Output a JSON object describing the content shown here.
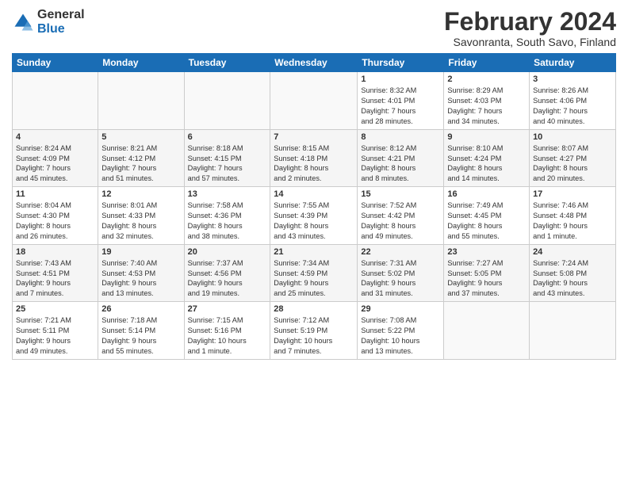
{
  "logo": {
    "general": "General",
    "blue": "Blue"
  },
  "title": "February 2024",
  "subtitle": "Savonranta, South Savo, Finland",
  "headers": [
    "Sunday",
    "Monday",
    "Tuesday",
    "Wednesday",
    "Thursday",
    "Friday",
    "Saturday"
  ],
  "weeks": [
    [
      {
        "day": "",
        "info": ""
      },
      {
        "day": "",
        "info": ""
      },
      {
        "day": "",
        "info": ""
      },
      {
        "day": "",
        "info": ""
      },
      {
        "day": "1",
        "info": "Sunrise: 8:32 AM\nSunset: 4:01 PM\nDaylight: 7 hours\nand 28 minutes."
      },
      {
        "day": "2",
        "info": "Sunrise: 8:29 AM\nSunset: 4:03 PM\nDaylight: 7 hours\nand 34 minutes."
      },
      {
        "day": "3",
        "info": "Sunrise: 8:26 AM\nSunset: 4:06 PM\nDaylight: 7 hours\nand 40 minutes."
      }
    ],
    [
      {
        "day": "4",
        "info": "Sunrise: 8:24 AM\nSunset: 4:09 PM\nDaylight: 7 hours\nand 45 minutes."
      },
      {
        "day": "5",
        "info": "Sunrise: 8:21 AM\nSunset: 4:12 PM\nDaylight: 7 hours\nand 51 minutes."
      },
      {
        "day": "6",
        "info": "Sunrise: 8:18 AM\nSunset: 4:15 PM\nDaylight: 7 hours\nand 57 minutes."
      },
      {
        "day": "7",
        "info": "Sunrise: 8:15 AM\nSunset: 4:18 PM\nDaylight: 8 hours\nand 2 minutes."
      },
      {
        "day": "8",
        "info": "Sunrise: 8:12 AM\nSunset: 4:21 PM\nDaylight: 8 hours\nand 8 minutes."
      },
      {
        "day": "9",
        "info": "Sunrise: 8:10 AM\nSunset: 4:24 PM\nDaylight: 8 hours\nand 14 minutes."
      },
      {
        "day": "10",
        "info": "Sunrise: 8:07 AM\nSunset: 4:27 PM\nDaylight: 8 hours\nand 20 minutes."
      }
    ],
    [
      {
        "day": "11",
        "info": "Sunrise: 8:04 AM\nSunset: 4:30 PM\nDaylight: 8 hours\nand 26 minutes."
      },
      {
        "day": "12",
        "info": "Sunrise: 8:01 AM\nSunset: 4:33 PM\nDaylight: 8 hours\nand 32 minutes."
      },
      {
        "day": "13",
        "info": "Sunrise: 7:58 AM\nSunset: 4:36 PM\nDaylight: 8 hours\nand 38 minutes."
      },
      {
        "day": "14",
        "info": "Sunrise: 7:55 AM\nSunset: 4:39 PM\nDaylight: 8 hours\nand 43 minutes."
      },
      {
        "day": "15",
        "info": "Sunrise: 7:52 AM\nSunset: 4:42 PM\nDaylight: 8 hours\nand 49 minutes."
      },
      {
        "day": "16",
        "info": "Sunrise: 7:49 AM\nSunset: 4:45 PM\nDaylight: 8 hours\nand 55 minutes."
      },
      {
        "day": "17",
        "info": "Sunrise: 7:46 AM\nSunset: 4:48 PM\nDaylight: 9 hours\nand 1 minute."
      }
    ],
    [
      {
        "day": "18",
        "info": "Sunrise: 7:43 AM\nSunset: 4:51 PM\nDaylight: 9 hours\nand 7 minutes."
      },
      {
        "day": "19",
        "info": "Sunrise: 7:40 AM\nSunset: 4:53 PM\nDaylight: 9 hours\nand 13 minutes."
      },
      {
        "day": "20",
        "info": "Sunrise: 7:37 AM\nSunset: 4:56 PM\nDaylight: 9 hours\nand 19 minutes."
      },
      {
        "day": "21",
        "info": "Sunrise: 7:34 AM\nSunset: 4:59 PM\nDaylight: 9 hours\nand 25 minutes."
      },
      {
        "day": "22",
        "info": "Sunrise: 7:31 AM\nSunset: 5:02 PM\nDaylight: 9 hours\nand 31 minutes."
      },
      {
        "day": "23",
        "info": "Sunrise: 7:27 AM\nSunset: 5:05 PM\nDaylight: 9 hours\nand 37 minutes."
      },
      {
        "day": "24",
        "info": "Sunrise: 7:24 AM\nSunset: 5:08 PM\nDaylight: 9 hours\nand 43 minutes."
      }
    ],
    [
      {
        "day": "25",
        "info": "Sunrise: 7:21 AM\nSunset: 5:11 PM\nDaylight: 9 hours\nand 49 minutes."
      },
      {
        "day": "26",
        "info": "Sunrise: 7:18 AM\nSunset: 5:14 PM\nDaylight: 9 hours\nand 55 minutes."
      },
      {
        "day": "27",
        "info": "Sunrise: 7:15 AM\nSunset: 5:16 PM\nDaylight: 10 hours\nand 1 minute."
      },
      {
        "day": "28",
        "info": "Sunrise: 7:12 AM\nSunset: 5:19 PM\nDaylight: 10 hours\nand 7 minutes."
      },
      {
        "day": "29",
        "info": "Sunrise: 7:08 AM\nSunset: 5:22 PM\nDaylight: 10 hours\nand 13 minutes."
      },
      {
        "day": "",
        "info": ""
      },
      {
        "day": "",
        "info": ""
      }
    ]
  ]
}
